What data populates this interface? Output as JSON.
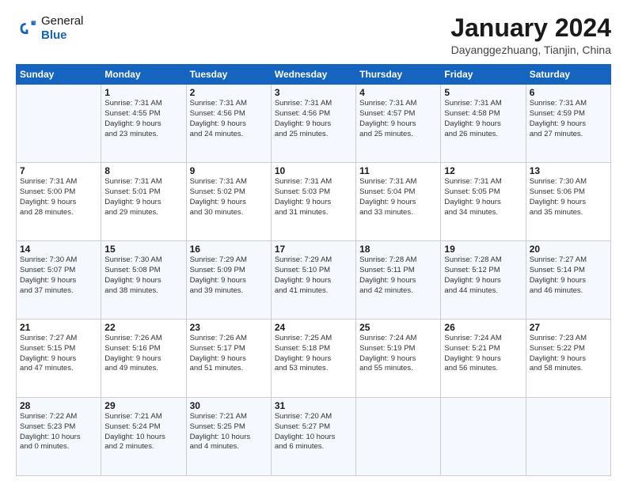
{
  "header": {
    "logo_line1": "General",
    "logo_line2": "Blue",
    "month": "January 2024",
    "location": "Dayanggezhuang, Tianjin, China"
  },
  "weekdays": [
    "Sunday",
    "Monday",
    "Tuesday",
    "Wednesday",
    "Thursday",
    "Friday",
    "Saturday"
  ],
  "weeks": [
    [
      {
        "day": "",
        "info": ""
      },
      {
        "day": "1",
        "info": "Sunrise: 7:31 AM\nSunset: 4:55 PM\nDaylight: 9 hours\nand 23 minutes."
      },
      {
        "day": "2",
        "info": "Sunrise: 7:31 AM\nSunset: 4:56 PM\nDaylight: 9 hours\nand 24 minutes."
      },
      {
        "day": "3",
        "info": "Sunrise: 7:31 AM\nSunset: 4:56 PM\nDaylight: 9 hours\nand 25 minutes."
      },
      {
        "day": "4",
        "info": "Sunrise: 7:31 AM\nSunset: 4:57 PM\nDaylight: 9 hours\nand 25 minutes."
      },
      {
        "day": "5",
        "info": "Sunrise: 7:31 AM\nSunset: 4:58 PM\nDaylight: 9 hours\nand 26 minutes."
      },
      {
        "day": "6",
        "info": "Sunrise: 7:31 AM\nSunset: 4:59 PM\nDaylight: 9 hours\nand 27 minutes."
      }
    ],
    [
      {
        "day": "7",
        "info": "Sunrise: 7:31 AM\nSunset: 5:00 PM\nDaylight: 9 hours\nand 28 minutes."
      },
      {
        "day": "8",
        "info": "Sunrise: 7:31 AM\nSunset: 5:01 PM\nDaylight: 9 hours\nand 29 minutes."
      },
      {
        "day": "9",
        "info": "Sunrise: 7:31 AM\nSunset: 5:02 PM\nDaylight: 9 hours\nand 30 minutes."
      },
      {
        "day": "10",
        "info": "Sunrise: 7:31 AM\nSunset: 5:03 PM\nDaylight: 9 hours\nand 31 minutes."
      },
      {
        "day": "11",
        "info": "Sunrise: 7:31 AM\nSunset: 5:04 PM\nDaylight: 9 hours\nand 33 minutes."
      },
      {
        "day": "12",
        "info": "Sunrise: 7:31 AM\nSunset: 5:05 PM\nDaylight: 9 hours\nand 34 minutes."
      },
      {
        "day": "13",
        "info": "Sunrise: 7:30 AM\nSunset: 5:06 PM\nDaylight: 9 hours\nand 35 minutes."
      }
    ],
    [
      {
        "day": "14",
        "info": "Sunrise: 7:30 AM\nSunset: 5:07 PM\nDaylight: 9 hours\nand 37 minutes."
      },
      {
        "day": "15",
        "info": "Sunrise: 7:30 AM\nSunset: 5:08 PM\nDaylight: 9 hours\nand 38 minutes."
      },
      {
        "day": "16",
        "info": "Sunrise: 7:29 AM\nSunset: 5:09 PM\nDaylight: 9 hours\nand 39 minutes."
      },
      {
        "day": "17",
        "info": "Sunrise: 7:29 AM\nSunset: 5:10 PM\nDaylight: 9 hours\nand 41 minutes."
      },
      {
        "day": "18",
        "info": "Sunrise: 7:28 AM\nSunset: 5:11 PM\nDaylight: 9 hours\nand 42 minutes."
      },
      {
        "day": "19",
        "info": "Sunrise: 7:28 AM\nSunset: 5:12 PM\nDaylight: 9 hours\nand 44 minutes."
      },
      {
        "day": "20",
        "info": "Sunrise: 7:27 AM\nSunset: 5:14 PM\nDaylight: 9 hours\nand 46 minutes."
      }
    ],
    [
      {
        "day": "21",
        "info": "Sunrise: 7:27 AM\nSunset: 5:15 PM\nDaylight: 9 hours\nand 47 minutes."
      },
      {
        "day": "22",
        "info": "Sunrise: 7:26 AM\nSunset: 5:16 PM\nDaylight: 9 hours\nand 49 minutes."
      },
      {
        "day": "23",
        "info": "Sunrise: 7:26 AM\nSunset: 5:17 PM\nDaylight: 9 hours\nand 51 minutes."
      },
      {
        "day": "24",
        "info": "Sunrise: 7:25 AM\nSunset: 5:18 PM\nDaylight: 9 hours\nand 53 minutes."
      },
      {
        "day": "25",
        "info": "Sunrise: 7:24 AM\nSunset: 5:19 PM\nDaylight: 9 hours\nand 55 minutes."
      },
      {
        "day": "26",
        "info": "Sunrise: 7:24 AM\nSunset: 5:21 PM\nDaylight: 9 hours\nand 56 minutes."
      },
      {
        "day": "27",
        "info": "Sunrise: 7:23 AM\nSunset: 5:22 PM\nDaylight: 9 hours\nand 58 minutes."
      }
    ],
    [
      {
        "day": "28",
        "info": "Sunrise: 7:22 AM\nSunset: 5:23 PM\nDaylight: 10 hours\nand 0 minutes."
      },
      {
        "day": "29",
        "info": "Sunrise: 7:21 AM\nSunset: 5:24 PM\nDaylight: 10 hours\nand 2 minutes."
      },
      {
        "day": "30",
        "info": "Sunrise: 7:21 AM\nSunset: 5:25 PM\nDaylight: 10 hours\nand 4 minutes."
      },
      {
        "day": "31",
        "info": "Sunrise: 7:20 AM\nSunset: 5:27 PM\nDaylight: 10 hours\nand 6 minutes."
      },
      {
        "day": "",
        "info": ""
      },
      {
        "day": "",
        "info": ""
      },
      {
        "day": "",
        "info": ""
      }
    ]
  ]
}
